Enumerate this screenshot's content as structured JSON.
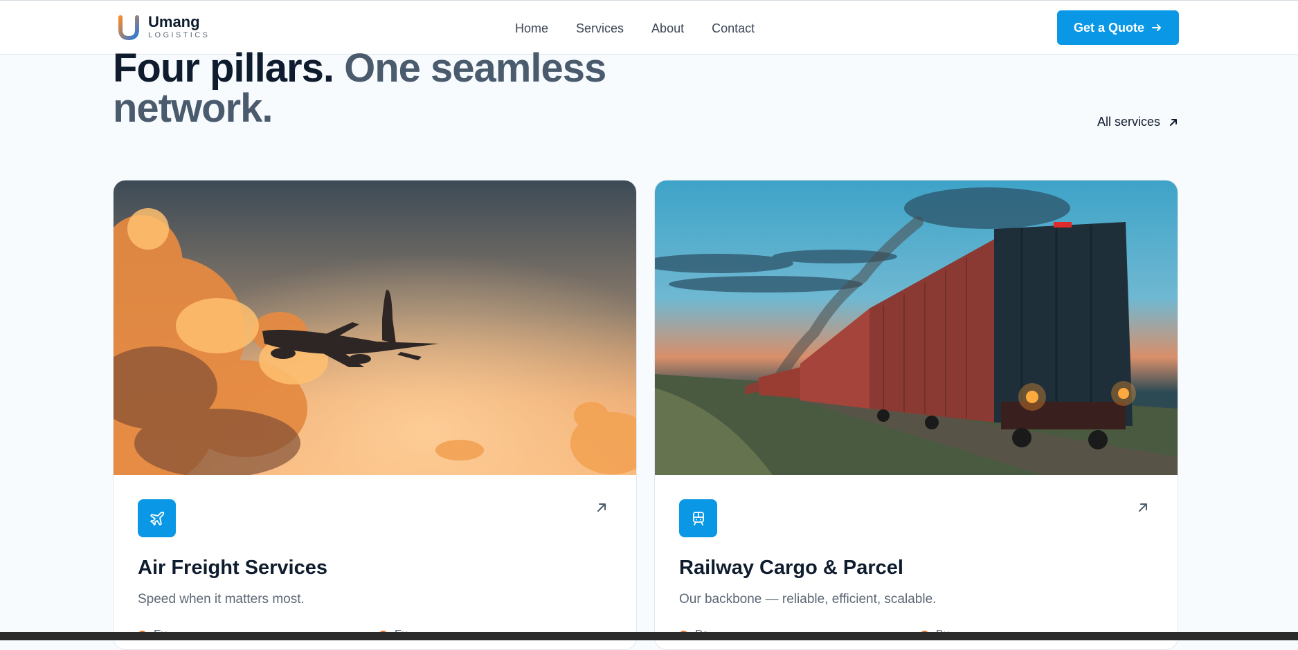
{
  "brand": {
    "name": "Umang",
    "tagline": "LOGISTICS"
  },
  "nav": {
    "items": [
      "Home",
      "Services",
      "About",
      "Contact"
    ]
  },
  "header": {
    "cta_label": "Get a Quote"
  },
  "section": {
    "title_dark": "Four pillars.",
    "title_muted": "One seamless network.",
    "link_label": "All services"
  },
  "cards": [
    {
      "title": "Air Freight Services",
      "description": "Speed when it matters most.",
      "icon": "plane-icon",
      "features": [
        "Ex",
        "Ex"
      ]
    },
    {
      "title": "Railway Cargo & Parcel",
      "description": "Our backbone — reliable, efficient, scalable.",
      "icon": "train-icon",
      "features": [
        "Pa",
        "Bu"
      ]
    }
  ],
  "colors": {
    "accent": "#0a98e6",
    "dark": "#0f1c2e",
    "muted": "#4a5b6d",
    "feature": "#e56f2b"
  }
}
